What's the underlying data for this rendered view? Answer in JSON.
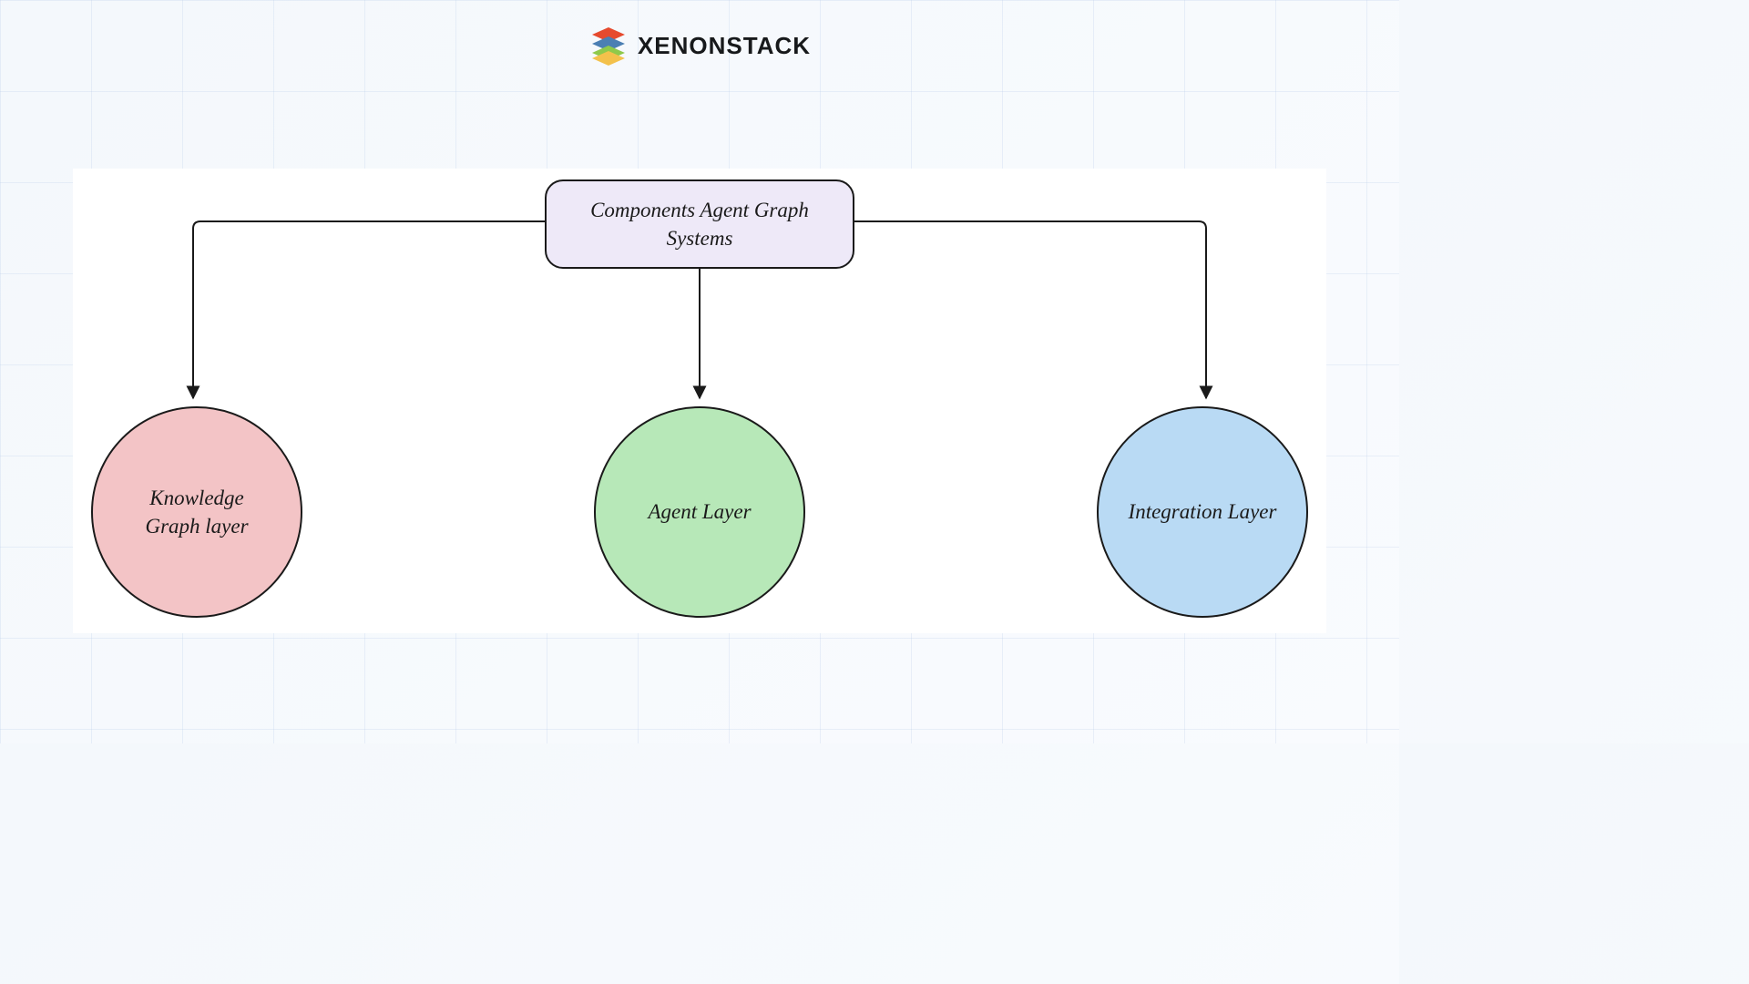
{
  "brand": {
    "name": "XENONSTACK"
  },
  "diagram": {
    "root": {
      "label": "Components Agent Graph Systems"
    },
    "left": {
      "label": "Knowledge Graph layer"
    },
    "center": {
      "label": "Agent Layer"
    },
    "right": {
      "label": "Integration Layer"
    },
    "colors": {
      "root_fill": "#eee9f8",
      "left_fill": "#f3c4c6",
      "center_fill": "#b7e8b8",
      "right_fill": "#b9daf4",
      "stroke": "#1a1a1a"
    }
  }
}
